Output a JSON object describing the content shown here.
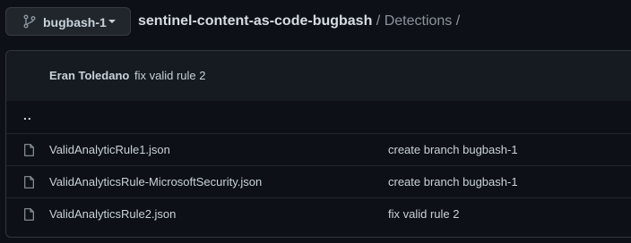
{
  "header": {
    "branch_label": "bugbash-1",
    "branch_icon": "git-branch-icon",
    "caret_icon": "triangle-down-icon",
    "repo_name": "sentinel-content-as-code-bugbash",
    "separator": " / ",
    "folder": "Detections",
    "trailing_separator": " /"
  },
  "latest_commit": {
    "author": "Eran Toledano",
    "message": "fix valid rule 2"
  },
  "up_link": "..",
  "files": [
    {
      "name": "ValidAnalyticRule1.json",
      "commit": "create branch bugbash-1",
      "icon": "file-icon"
    },
    {
      "name": "ValidAnalyticsRule-MicrosoftSecurity.json",
      "commit": "create branch bugbash-1",
      "icon": "file-icon"
    },
    {
      "name": "ValidAnalyticsRule2.json",
      "commit": "fix valid rule 2",
      "icon": "file-icon"
    }
  ],
  "colors": {
    "background": "#0d1117",
    "header_bg": "#161b22",
    "border": "#30363d",
    "text": "#c9d1d9",
    "muted": "#8b949e"
  }
}
